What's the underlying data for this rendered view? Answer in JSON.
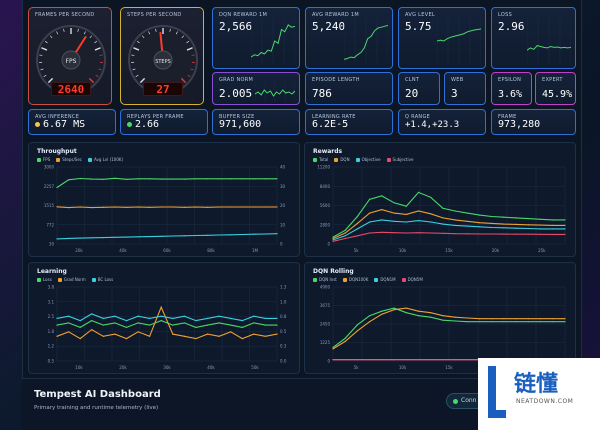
{
  "gauges": [
    {
      "label": "FRAMES PER SECOND",
      "dial_label": "FPS",
      "readout": "2640",
      "level": 0.62,
      "color": "#e53b3b"
    },
    {
      "label": "STEPS PER SECOND",
      "dial_label": "STEPS",
      "readout": "27",
      "level": 0.48,
      "color": "#e53b3b"
    }
  ],
  "top_tiles": [
    {
      "label": "DQN REWARD 1M",
      "value": "2,566",
      "border": "#2e6fd8",
      "spark": [
        0.15,
        0.2,
        0.18,
        0.25,
        0.22,
        0.3,
        0.28,
        0.5,
        0.45,
        0.75,
        0.7,
        0.85,
        0.8,
        0.82
      ]
    },
    {
      "label": "AVG REWARD 1M",
      "value": "5,240",
      "border": "#2e6fd8",
      "spark": [
        0.1,
        0.12,
        0.15,
        0.14,
        0.2,
        0.25,
        0.35,
        0.55,
        0.6,
        0.72,
        0.78,
        0.8,
        0.82,
        0.84
      ]
    },
    {
      "label": "AVG LEVEL",
      "value": "5.75",
      "border": "#2e6fd8",
      "spark": [
        0.5,
        0.52,
        0.5,
        0.55,
        0.58,
        0.6,
        0.62,
        0.64,
        0.66,
        0.7,
        0.72,
        0.74,
        0.75,
        0.76
      ]
    },
    {
      "label": "LOSS",
      "value": "2.96",
      "border": "#2e6fd8",
      "spark": [
        0.3,
        0.35,
        0.32,
        0.4,
        0.38,
        0.36,
        0.35,
        0.38,
        0.36,
        0.37,
        0.35,
        0.36,
        0.35,
        0.36
      ]
    }
  ],
  "mid_tiles": [
    {
      "label": "GRAD NORM",
      "value": "2.005",
      "border": "#8a4fd8",
      "spark": [
        0.4,
        0.5,
        0.35,
        0.6,
        0.45,
        0.55,
        0.3,
        0.5,
        0.4,
        0.6,
        0.45,
        0.5,
        0.4,
        0.55
      ]
    },
    {
      "label": "EPISODE LENGTH",
      "value": "786",
      "border": "#2e6fd8"
    },
    {
      "label": "CLNT",
      "value": "20",
      "border": "#2e6fd8"
    },
    {
      "label": "WEB",
      "value": "3",
      "border": "#2e6fd8"
    },
    {
      "label": "EPSILON",
      "value": "3.6%",
      "border": "#c040c8"
    },
    {
      "label": "EXPERT",
      "value": "45.9%",
      "border": "#c040c8"
    }
  ],
  "row3_tiles": [
    {
      "label": "AVG INFERENCE",
      "value": "6.67 MS",
      "border": "#2e6fd8",
      "indicator": "#f2c84b"
    },
    {
      "label": "REPLAYS PER FRAME",
      "value": "2.66",
      "border": "#2e6fd8",
      "indicator": "#4ad86a"
    },
    {
      "label": "BUFFER SIZE",
      "value": "971,600",
      "border": "#2e6fd8"
    },
    {
      "label": "LEARNING RATE",
      "value": "6.2E-5",
      "border": "#2e6fd8"
    },
    {
      "label": "Q RANGE",
      "value": "+1.4,+23.3",
      "border": "#2e6fd8"
    },
    {
      "label": "FRAME",
      "value": "973,280",
      "border": "#2e6fd8"
    }
  ],
  "chart_data": [
    {
      "type": "line",
      "title": "Throughput",
      "series": [
        {
          "name": "FPS",
          "color": "#4ad86a",
          "values": [
            2200,
            2500,
            2550,
            2530,
            2520,
            2560,
            2520,
            2540,
            2540,
            2530,
            2530,
            2530,
            2540,
            2540,
            2540,
            2540,
            2540,
            2540,
            2540,
            2540
          ]
        },
        {
          "name": "Steps/Sec",
          "color": "#f0a030",
          "values": [
            1450,
            1420,
            1440,
            1420,
            1430,
            1440,
            1430,
            1440,
            1430,
            1440,
            1440,
            1430,
            1440,
            1430,
            1440,
            1440,
            1440,
            1440,
            1440,
            1440
          ]
        },
        {
          "name": "Avg Lvl (100K)",
          "color": "#3ad0e0",
          "values": [
            200,
            220,
            230,
            240,
            250,
            260,
            270,
            280,
            290,
            300,
            310,
            320,
            330,
            340,
            350,
            360,
            370,
            380,
            390,
            400
          ]
        }
      ],
      "ylim": [
        0,
        3000
      ],
      "y_ticks": [
        "3000",
        "2257",
        "1515",
        "772",
        "30"
      ],
      "y2_ticks": [
        "40",
        "30",
        "20",
        "10",
        "0"
      ],
      "x_ticks": [
        "20k",
        "40k",
        "60k",
        "80k",
        "1M"
      ]
    },
    {
      "type": "line",
      "title": "Rewards",
      "series": [
        {
          "name": "Total",
          "color": "#4ad86a",
          "values": [
            1000,
            2000,
            4000,
            6500,
            7000,
            6000,
            5500,
            7500,
            6800,
            5200,
            4800,
            4500,
            4200,
            4000,
            3900,
            3800,
            3700,
            3600,
            3500,
            3500
          ]
        },
        {
          "name": "DQN",
          "color": "#f0a030",
          "values": [
            800,
            1600,
            3000,
            4500,
            5000,
            4500,
            4300,
            4800,
            4400,
            3800,
            3500,
            3300,
            3100,
            3000,
            2900,
            2850,
            2800,
            2750,
            2700,
            2700
          ]
        },
        {
          "name": "Objective",
          "color": "#3ad0e0",
          "values": [
            600,
            1200,
            2200,
            3200,
            3500,
            3300,
            3200,
            3400,
            3200,
            2900,
            2700,
            2600,
            2500,
            2400,
            2350,
            2300,
            2250,
            2200,
            2200,
            2200
          ]
        },
        {
          "name": "Subjective",
          "color": "#e84a6a",
          "values": [
            400,
            800,
            1200,
            1600,
            1700,
            1650,
            1600,
            1650,
            1600,
            1550,
            1500,
            1480,
            1460,
            1450,
            1440,
            1430,
            1420,
            1410,
            1400,
            1400
          ]
        }
      ],
      "ylim": [
        0,
        11200
      ],
      "y_ticks": [
        "11200",
        "8400",
        "5600",
        "2800",
        "0"
      ],
      "x_ticks": [
        "5k",
        "10k",
        "15k",
        "20k",
        "25k"
      ]
    },
    {
      "type": "line",
      "title": "Learning",
      "series": [
        {
          "name": "Loss",
          "color": "#4ad86a",
          "values": [
            2.1,
            2.2,
            2.0,
            2.3,
            2.1,
            2.2,
            2.0,
            2.2,
            2.1,
            2.3,
            2.1,
            2.2,
            2.0,
            2.1,
            2.2,
            2.1,
            2.0,
            2.2,
            2.1,
            2.1
          ]
        },
        {
          "name": "Grad Norm",
          "color": "#f0a030",
          "values": [
            1.6,
            1.8,
            1.5,
            1.9,
            1.6,
            1.7,
            1.5,
            1.8,
            1.6,
            2.9,
            1.7,
            1.6,
            1.5,
            1.7,
            1.6,
            1.8,
            1.5,
            1.7,
            1.6,
            1.7
          ]
        },
        {
          "name": "BC Loss",
          "color": "#3ad0e0",
          "values": [
            2.4,
            2.5,
            2.3,
            2.6,
            2.4,
            2.5,
            2.3,
            2.5,
            2.4,
            2.5,
            2.4,
            2.5,
            2.3,
            2.4,
            2.5,
            2.4,
            2.3,
            2.5,
            2.4,
            2.4
          ]
        }
      ],
      "ylim": [
        0.5,
        3.8
      ],
      "y_ticks": [
        "3.8",
        "3.1",
        "2.5",
        "1.8",
        "1.2",
        "0.5"
      ],
      "y2_ticks": [
        "1.3",
        "1.0",
        "0.8",
        "0.5",
        "0.3",
        "0.0"
      ],
      "x_ticks": [
        "10k",
        "20k",
        "30k",
        "40k",
        "50k"
      ]
    },
    {
      "type": "line",
      "title": "DQN Rolling",
      "series": [
        {
          "name": "DQN Inst",
          "color": "#4ad86a",
          "values": [
            900,
            1500,
            2400,
            3000,
            3300,
            3500,
            3200,
            3000,
            2900,
            2700,
            2650,
            2600,
            2600,
            2600,
            2600,
            2600,
            2600,
            2600,
            2600,
            2600
          ]
        },
        {
          "name": "DQN100K",
          "color": "#f0a030",
          "values": [
            800,
            1300,
            2000,
            2600,
            3100,
            3400,
            3500,
            3300,
            3200,
            3000,
            2900,
            2850,
            2800,
            2800,
            2800,
            2800,
            2800,
            2800,
            2800,
            2800
          ]
        },
        {
          "name": "DQN1M",
          "color": "#3ad0e0",
          "values": [
            100,
            100,
            100,
            100,
            100,
            100,
            100,
            100,
            100,
            100,
            100,
            100,
            100,
            100,
            100,
            100,
            100,
            100,
            100,
            100
          ]
        },
        {
          "name": "DQN5M",
          "color": "#e84a6a",
          "values": [
            80,
            80,
            80,
            80,
            80,
            80,
            80,
            80,
            80,
            80,
            80,
            80,
            80,
            80,
            80,
            80,
            80,
            80,
            80,
            80
          ]
        }
      ],
      "ylim": [
        0,
        4900
      ],
      "y_ticks": [
        "4900",
        "3675",
        "2450",
        "1225",
        "0"
      ],
      "x_ticks": [
        "5k",
        "10k",
        "15k",
        "20k",
        "25k"
      ]
    }
  ],
  "footer": {
    "title": "Tempest AI Dashboard",
    "subtitle": "Primary training and runtime telemetry (live)",
    "status": "Conn"
  },
  "watermark": {
    "text": "链懂",
    "sub": "NEATDOWN.COM"
  }
}
